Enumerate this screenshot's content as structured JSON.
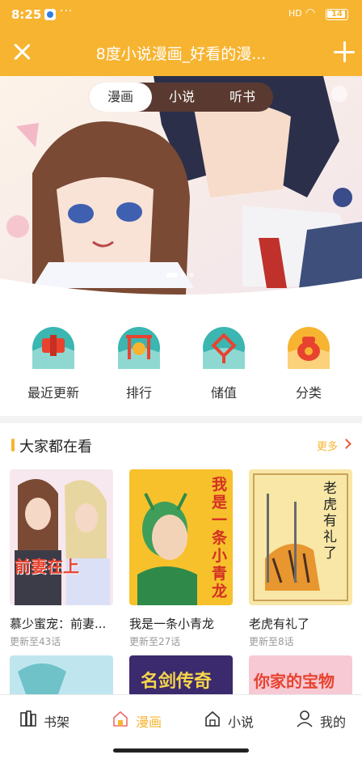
{
  "status_bar": {
    "time": "8:25",
    "dots": "···",
    "signal": "HD",
    "battery": "14"
  },
  "title_bar": {
    "title": "8度小说漫画_好看的漫..."
  },
  "tabs": [
    {
      "label": "漫画",
      "active": true
    },
    {
      "label": "小说",
      "active": false
    },
    {
      "label": "听书",
      "active": false
    }
  ],
  "quick_menu": [
    {
      "label": "最近更新",
      "icon": "update-icon"
    },
    {
      "label": "排行",
      "icon": "rank-gong-icon"
    },
    {
      "label": "储值",
      "icon": "knot-icon"
    },
    {
      "label": "分类",
      "icon": "category-bag-icon"
    }
  ],
  "section": {
    "title": "大家都在看",
    "more": "更多"
  },
  "books": [
    {
      "name": "慕少蜜宠：前妻...",
      "update": "更新至43话",
      "cover_text": "前妻在上"
    },
    {
      "name": "我是一条小青龙",
      "update": "更新至27话",
      "cover_text": "我是一条小青龙"
    },
    {
      "name": "老虎有礼了",
      "update": "更新至8话",
      "cover_text": "老虎有礼了"
    }
  ],
  "second_row_titles": [
    "",
    "名剑传奇",
    "你家的宝物"
  ],
  "bottom_nav": [
    {
      "label": "书架",
      "icon": "bookshelf-icon",
      "active": false
    },
    {
      "label": "漫画",
      "icon": "home-icon",
      "active": true
    },
    {
      "label": "小说",
      "icon": "home-icon",
      "active": false
    },
    {
      "label": "我的",
      "icon": "user-icon",
      "active": false
    }
  ],
  "colors": {
    "accent": "#f7b431",
    "more_arrow": "#e85a3a",
    "tab_bg": "#5a3a30"
  }
}
